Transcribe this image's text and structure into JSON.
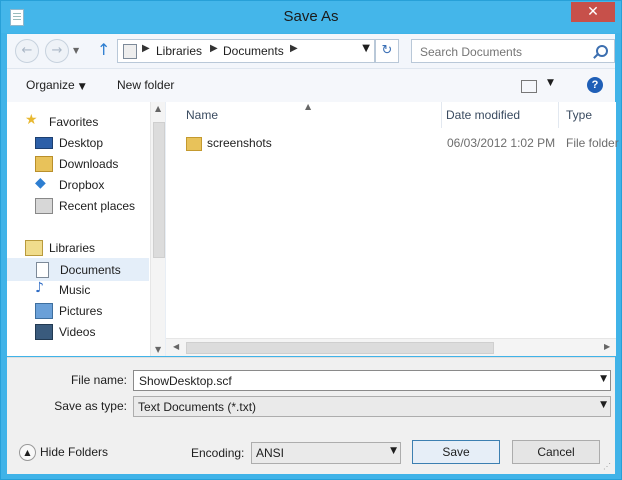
{
  "window": {
    "title": "Save As",
    "close_glyph": "✕"
  },
  "nav": {
    "back_glyph": "←",
    "forward_glyph": "→",
    "up_glyph": "↑",
    "breadcrumb": [
      "Libraries",
      "Documents"
    ],
    "refresh_glyph": "↻",
    "search_placeholder": "Search Documents"
  },
  "toolbar": {
    "organize": "Organize",
    "new_folder": "New folder",
    "help_glyph": "?"
  },
  "sidebar": {
    "favorites": "Favorites",
    "favorites_items": [
      "Desktop",
      "Downloads",
      "Dropbox",
      "Recent places"
    ],
    "libraries": "Libraries",
    "libraries_items": [
      "Documents",
      "Music",
      "Pictures",
      "Videos"
    ],
    "selected": "Documents"
  },
  "columns": {
    "name": "Name",
    "date": "Date modified",
    "type": "Type"
  },
  "files": [
    {
      "name": "screenshots",
      "date": "06/03/2012 1:02 PM",
      "type": "File folder"
    }
  ],
  "form": {
    "file_name_label": "File name:",
    "file_name_value": "ShowDesktop.scf",
    "save_as_type_label": "Save as type:",
    "save_as_type_value": "Text Documents (*.txt)",
    "encoding_label": "Encoding:",
    "encoding_value": "ANSI",
    "save": "Save",
    "cancel": "Cancel",
    "hide_folders": "Hide Folders"
  },
  "colors": {
    "titlebar": "#44b6ea",
    "close": "#c7504a",
    "selection": "#e4eef9",
    "folder": "#e8c25a"
  },
  "icons": [
    "document-icon",
    "back-icon",
    "forward-icon",
    "up-arrow-icon",
    "library-icon",
    "refresh-icon",
    "search-icon",
    "view-icon",
    "help-icon",
    "star-icon",
    "desktop-icon",
    "downloads-icon",
    "dropbox-icon",
    "recent-places-icon",
    "music-icon",
    "pictures-icon",
    "videos-icon",
    "folder-icon",
    "hide-folders-icon"
  ]
}
